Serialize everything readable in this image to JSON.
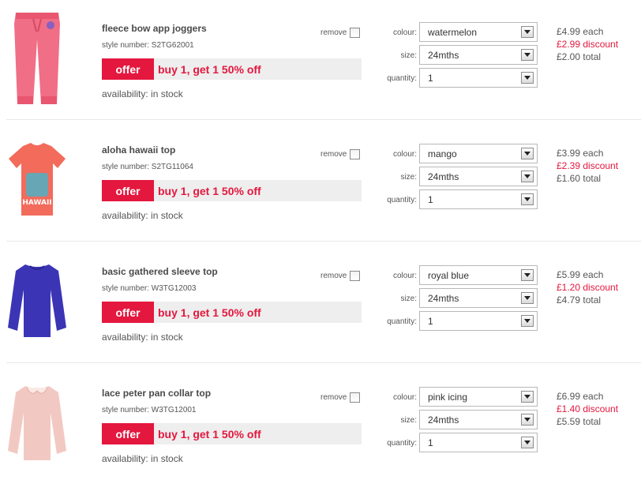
{
  "labels": {
    "remove": "remove",
    "colour": "colour:",
    "size": "size:",
    "quantity": "quantity:",
    "offer_badge": "offer"
  },
  "items": [
    {
      "name": "fleece bow app joggers",
      "style_number": "style number: S2TG62001",
      "offer_text": "buy 1, get 1 50% off",
      "availability": "availability: in stock",
      "colour": "watermelon",
      "size": "24mths",
      "quantity": "1",
      "each": "£4.99 each",
      "discount": "£2.99 discount",
      "total": "£2.00 total",
      "image_icon": "pink-joggers-image",
      "garment_color": "#f06e86"
    },
    {
      "name": "aloha hawaii top",
      "style_number": "style number: S2TG11064",
      "offer_text": "buy 1, get 1 50% off",
      "availability": "availability: in stock",
      "colour": "mango",
      "size": "24mths",
      "quantity": "1",
      "each": "£3.99 each",
      "discount": "£2.39 discount",
      "total": "£1.60 total",
      "image_icon": "coral-tshirt-image",
      "garment_color": "#f26b5b"
    },
    {
      "name": "basic gathered sleeve top",
      "style_number": "style number: W3TG12003",
      "offer_text": "buy 1, get 1 50% off",
      "availability": "availability: in stock",
      "colour": "royal blue",
      "size": "24mths",
      "quantity": "1",
      "each": "£5.99 each",
      "discount": "£1.20 discount",
      "total": "£4.79 total",
      "image_icon": "blue-longsleeve-image",
      "garment_color": "#3b35b5"
    },
    {
      "name": "lace peter pan collar top",
      "style_number": "style number: W3TG12001",
      "offer_text": "buy 1, get 1 50% off",
      "availability": "availability: in stock",
      "colour": "pink icing",
      "size": "24mths",
      "quantity": "1",
      "each": "£6.99 each",
      "discount": "£1.40 discount",
      "total": "£5.59 total",
      "image_icon": "pink-collar-top-image",
      "garment_color": "#f2c9c2"
    }
  ],
  "colors": {
    "accent": "#e4173e",
    "bar": "#eeeeee"
  }
}
